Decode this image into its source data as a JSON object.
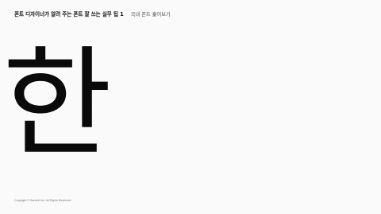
{
  "header": {
    "title": "폰트 디자이너가 알려 주는 폰트 잘 쓰는 실무 팁 1",
    "subtitle": "국내 폰트 훑어보기"
  },
  "main": {
    "glyph": "한"
  },
  "footer": {
    "copyright": "Copyright © Sandoll Inc. All Rights Reserved"
  }
}
